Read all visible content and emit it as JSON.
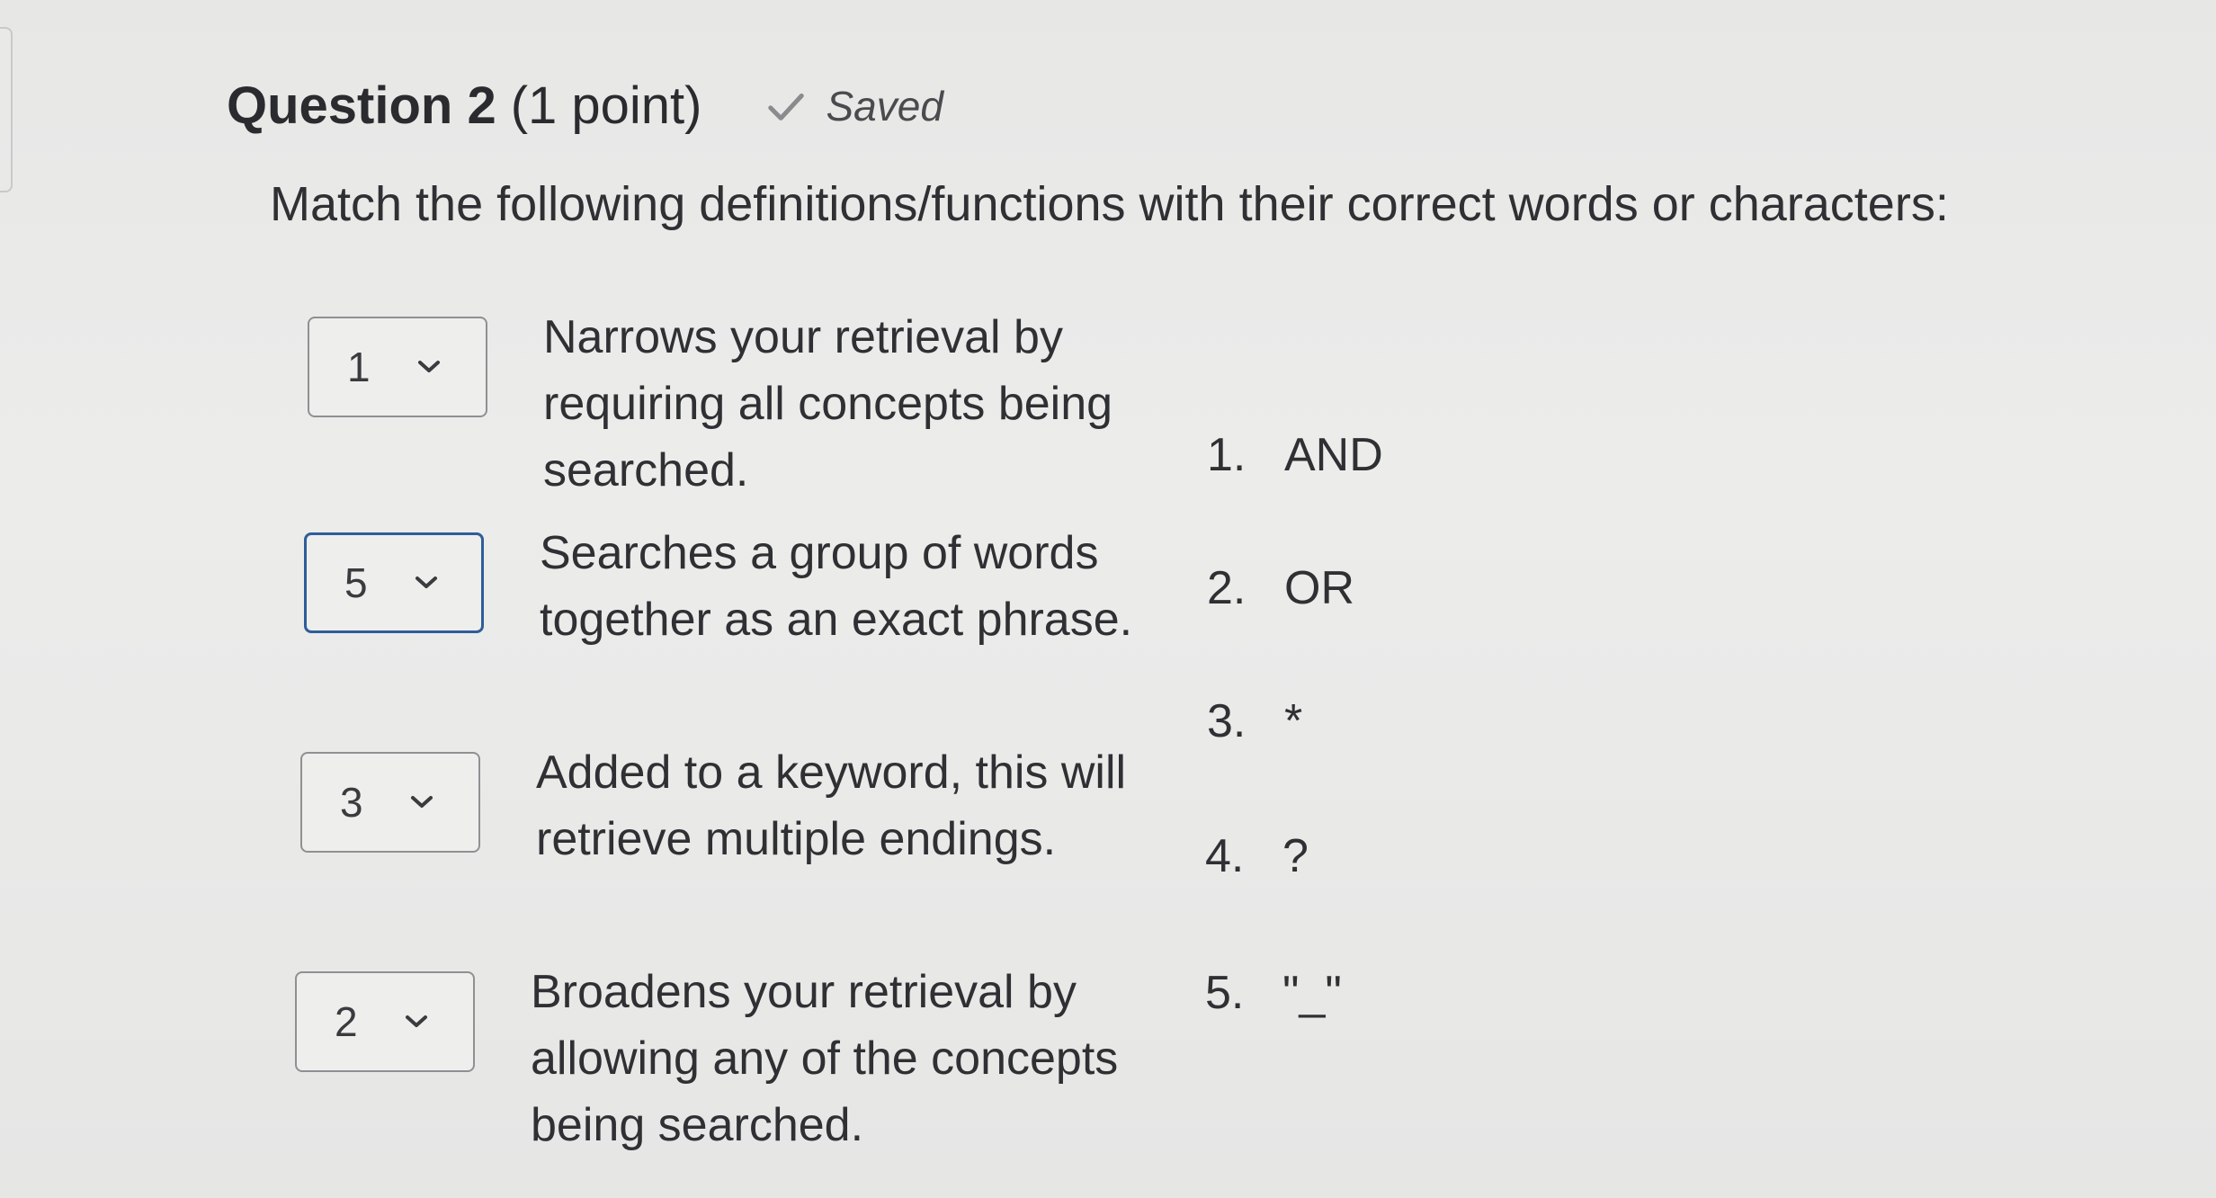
{
  "header": {
    "question_title": "Question 2",
    "points": "(1 point)",
    "status": "Saved"
  },
  "prompt": "Match the following definitions/functions with their correct words or characters:",
  "matches": [
    {
      "selected": "1",
      "definition": "Narrows your retrieval by requiring all concepts being searched."
    },
    {
      "selected": "5",
      "definition": "Searches a group of words together as an exact phrase."
    },
    {
      "selected": "3",
      "definition": "Added to a keyword, this will retrieve multiple endings."
    },
    {
      "selected": "2",
      "definition": "Broadens your retrieval by allowing any of the concepts being searched."
    }
  ],
  "options": [
    {
      "number": "1.",
      "label": "AND"
    },
    {
      "number": "2.",
      "label": "OR"
    },
    {
      "number": "3.",
      "label": "*"
    },
    {
      "number": "4.",
      "label": "?"
    },
    {
      "number": "5.",
      "label": "\"_\""
    }
  ],
  "icons": {
    "status": "checkmark-icon",
    "dropdown": "chevron-down-icon"
  },
  "colors": {
    "focus_border": "#2f5d99",
    "text": "#2f3033",
    "background": "#e9e9e8"
  }
}
